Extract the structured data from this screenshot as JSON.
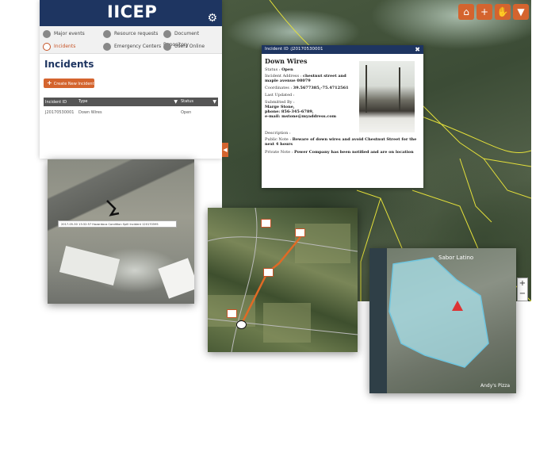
{
  "app": {
    "title": "IICEP"
  },
  "nav": {
    "items": [
      {
        "label": "Major events",
        "icon": "circle-dot-icon"
      },
      {
        "label": "Resource requests",
        "icon": "wrench-icon"
      },
      {
        "label": "Document Repository",
        "icon": "building-icon"
      },
      {
        "label": "Incidents",
        "icon": "target-icon",
        "active": true
      },
      {
        "label": "Emergency Centers",
        "icon": "hammer-icon"
      },
      {
        "label": "Users Online",
        "icon": "users-icon"
      }
    ]
  },
  "incidents": {
    "title": "Incidents",
    "create_label": "Create New Incident",
    "columns": [
      "Incident ID",
      "Type",
      "Status"
    ],
    "rows": [
      {
        "id": "J20170530001",
        "type": "Down Wires",
        "status": "Open"
      }
    ]
  },
  "popup": {
    "header": "Incident ID :J20170530001",
    "title": "Down Wires",
    "status_label": "Status : ",
    "status_value": "Open",
    "address_label": "Incident Address : ",
    "address_value": "chestnut street and maple avenue 08079",
    "coords_label": "Coordinates : ",
    "coords_value": "39.5677385,-75.4712561",
    "updated_label": "Last Updated :",
    "submitted_label": "Submitted By :",
    "submitted_name": "Marge Stone,",
    "submitted_phone": "phone: 856-345-6789,",
    "submitted_email": "e-mail: mstone@myaddress.com",
    "description_label": "Description :",
    "public_label": "Public Note : ",
    "public_value": "Beware of down wires and avoid Chestnut Street for the next 4 hours",
    "private_label": "Private Note : ",
    "private_value": "Power Company has been notified and are on location"
  },
  "inset1": {
    "tooltip": "2017-05-30 13:32:57 Hazardous Condition Spill Incident 120170595"
  },
  "inset3": {
    "places": [
      "Sabor Latino",
      "Andy's Pizza"
    ]
  },
  "toolbar": {
    "icons": [
      "home-icon",
      "plus-icon",
      "hand-icon",
      "filter-icon"
    ]
  },
  "zoom": {
    "in": "+",
    "out": "−"
  },
  "colors": {
    "navy": "#1e3561",
    "accent": "#d4642e",
    "boundary": "#e4e03a"
  }
}
